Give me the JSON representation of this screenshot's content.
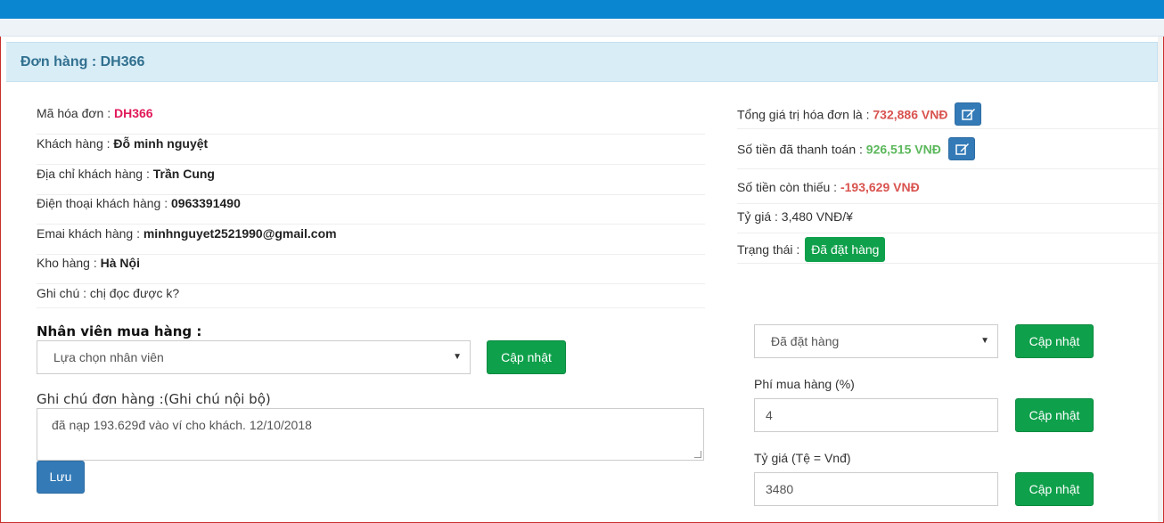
{
  "header": {
    "title": "Đơn hàng : DH366"
  },
  "invoice": {
    "code_label": "Mã hóa đơn : ",
    "code": "DH366",
    "customer_label": "Khách hàng : ",
    "customer": "Đỗ minh nguyệt",
    "address_label": "Địa chỉ khách hàng : ",
    "address": "Trần Cung",
    "phone_label": "Điện thoại khách hàng : ",
    "phone": "0963391490",
    "email_label": "Emai khách hàng : ",
    "email": "minhnguyet2521990@gmail.com",
    "warehouse_label": "Kho hàng : ",
    "warehouse": "Hà Nội",
    "note_label": "Ghi chú : ",
    "note": "chị đọc được k?"
  },
  "summary": {
    "total_label": "Tổng giá trị hóa đơn là : ",
    "total": "732,886 VNĐ",
    "paid_label": "Số tiền đã thanh toán : ",
    "paid": "926,515 VNĐ",
    "remaining_label": "Số tiền còn thiếu : ",
    "remaining": "-193,629 VNĐ",
    "rate_text": "Tỷ giá : 3,480 VNĐ/¥",
    "status_label": "Trạng thái : ",
    "status": "Đã đặt hàng",
    "edit_icon": "edit-icon"
  },
  "staff": {
    "heading": "Nhân viên mua hàng :",
    "select_value": "Lựa chọn nhân viên",
    "update_label": "Cập nhật"
  },
  "order_note": {
    "heading": "Ghi chú đơn hàng :(Ghi chú nội bộ)",
    "value": "đã nạp 193.629đ vào ví cho khách. 12/10/2018",
    "save_label": "Lưu"
  },
  "controls": {
    "status_select_value": "Đã đặt hàng",
    "status_update_label": "Cập nhật",
    "fee_label": "Phí mua hàng (%)",
    "fee_value": "4",
    "fee_update_label": "Cập nhật",
    "rate_label": "Tỷ giá (Tệ = Vnđ)",
    "rate_value": "3480",
    "rate_update_label": "Cập nhật"
  },
  "colors": {
    "topbar": "#0a85d0",
    "panel_head": "#d9edf7",
    "green_button": "#0fa04b",
    "blue_button": "#337ab7",
    "amount_red": "#d9534f",
    "amount_green": "#5cb85c",
    "code_pink": "#e0195a"
  }
}
